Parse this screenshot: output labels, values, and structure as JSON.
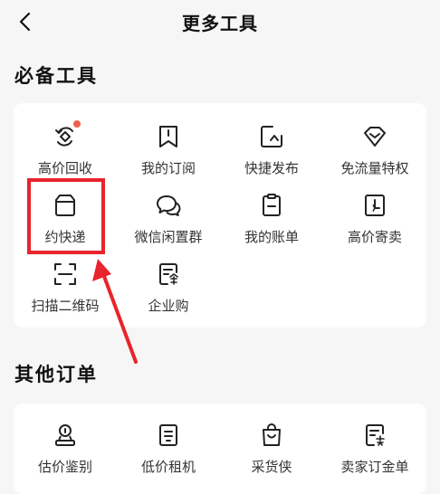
{
  "header": {
    "title": "更多工具",
    "back_icon": "chevron-left-icon"
  },
  "sections": {
    "essential": {
      "title": "必备工具",
      "items": [
        {
          "label": "高价回收",
          "icon": "recycle-icon",
          "badge": true
        },
        {
          "label": "我的订阅",
          "icon": "bookmark-icon"
        },
        {
          "label": "快捷发布",
          "icon": "publish-icon"
        },
        {
          "label": "免流量特权",
          "icon": "diamond-icon"
        },
        {
          "label": "约快递",
          "icon": "package-icon"
        },
        {
          "label": "微信闲置群",
          "icon": "chat-bubbles-icon"
        },
        {
          "label": "我的账单",
          "icon": "bill-icon"
        },
        {
          "label": "高价寄卖",
          "icon": "consign-icon"
        },
        {
          "label": "扫描二维码",
          "icon": "scan-icon"
        },
        {
          "label": "企业购",
          "icon": "enterprise-icon"
        }
      ]
    },
    "other_orders": {
      "title": "其他订单",
      "items": [
        {
          "label": "估价鉴别",
          "icon": "appraisal-icon"
        },
        {
          "label": "低价租机",
          "icon": "rent-phone-icon"
        },
        {
          "label": "采货侠",
          "icon": "shopping-bag-icon"
        },
        {
          "label": "卖家订金单",
          "icon": "seller-deposit-icon"
        }
      ]
    }
  },
  "colors": {
    "background": "#f6f6f6",
    "card": "#ffffff",
    "highlight": "#e8242c",
    "badge": "#f0604e"
  }
}
